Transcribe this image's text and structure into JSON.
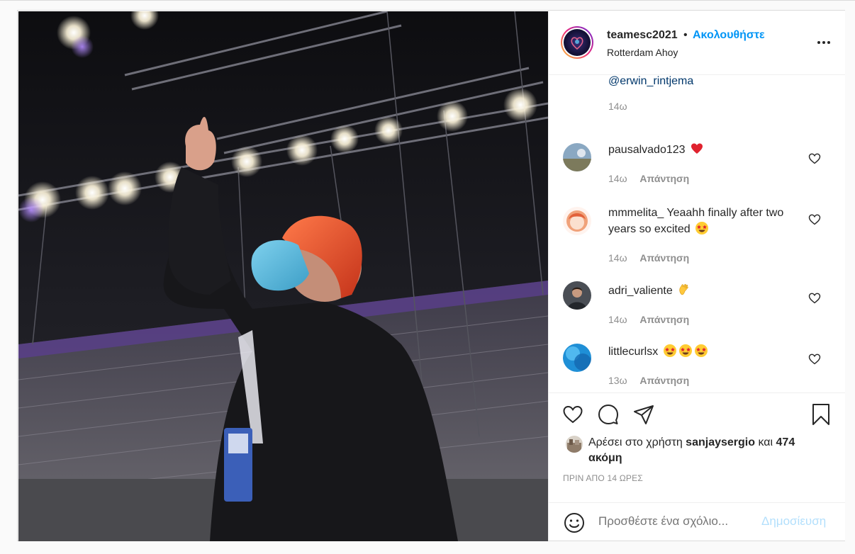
{
  "header": {
    "username": "teamesc2021",
    "separator": "•",
    "follow_label": "Ακολουθήστε",
    "location": "Rotterdam Ahoy"
  },
  "comments_section": {
    "top_mention": "@erwin_rintjema",
    "top_time": "14ω",
    "reply_label": "Απάντηση",
    "items": [
      {
        "user": "pausalvado123",
        "text": "",
        "emoji": "red-heart",
        "time": "14ω"
      },
      {
        "user": "mmmelita_",
        "text": "Yeaahh finally after two years so excited",
        "emoji": "star-struck",
        "time": "14ω"
      },
      {
        "user": "adri_valiente",
        "text": "",
        "emoji": "clapping-hands",
        "time": "14ω"
      },
      {
        "user": "littlecurlsx",
        "text": "",
        "emoji": "star-struck x3",
        "time": "13ω"
      }
    ]
  },
  "likes": {
    "prefix": "Αρέσει στο χρήστη",
    "user": "sanjaysergio",
    "conj": "και",
    "count": "474 ακόμη"
  },
  "timestamp": "ΠΡΙΝ ΑΠΟ 14 ΩΡΕΣ",
  "add_comment": {
    "placeholder": "Προσθέστε ένα σχόλιο...",
    "post_label": "Δημοσίευση"
  },
  "colors": {
    "link_blue": "#0095f6",
    "mention_blue": "#00376b",
    "muted": "#8e8e8e",
    "post_disabled": "#b2dffc",
    "heart_red": "#ed4956"
  }
}
